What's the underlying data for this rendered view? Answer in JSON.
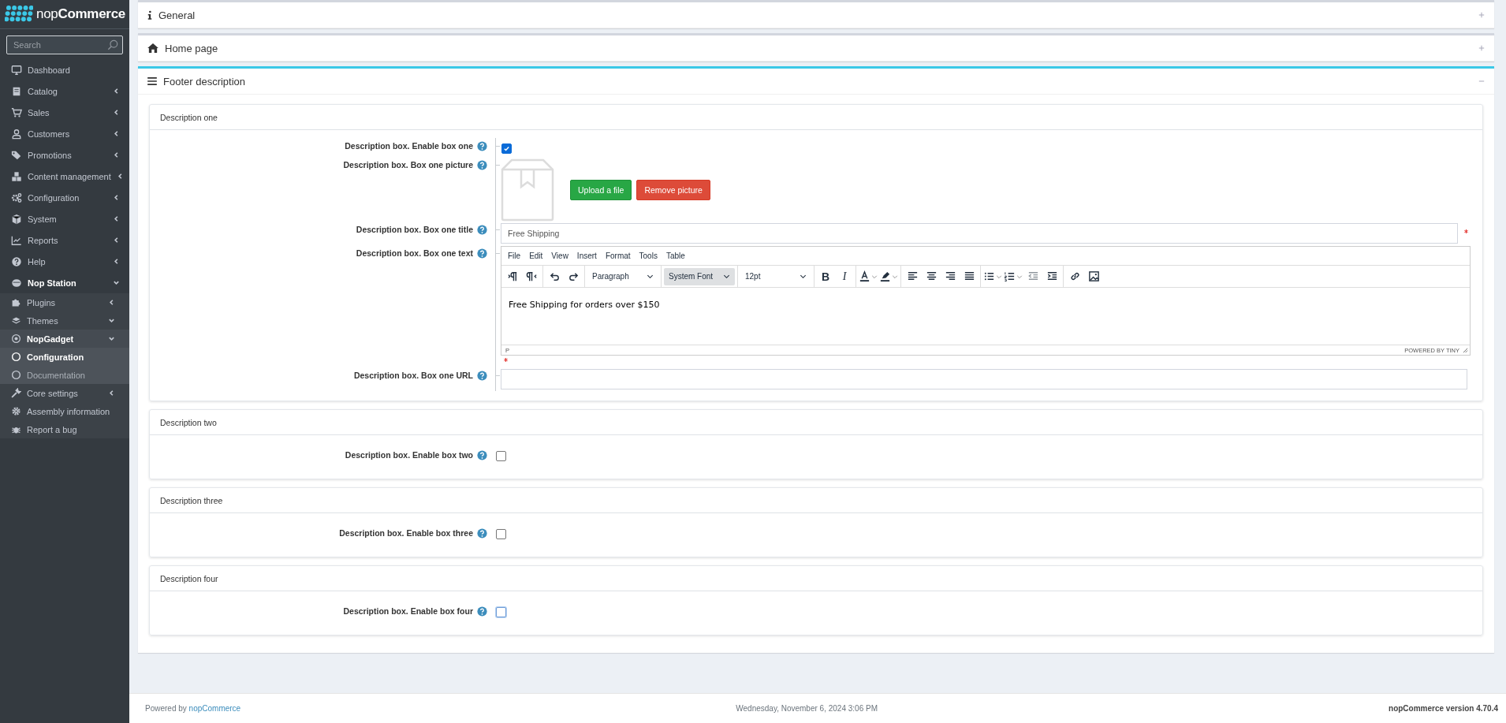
{
  "sidebar": {
    "logo": {
      "light": "nop",
      "bold": "Commerce"
    },
    "search": {
      "placeholder": "Search"
    },
    "items": [
      {
        "label": "Dashboard"
      },
      {
        "label": "Catalog",
        "expanded": false
      },
      {
        "label": "Sales",
        "expanded": false
      },
      {
        "label": "Customers",
        "expanded": false
      },
      {
        "label": "Promotions",
        "expanded": false
      },
      {
        "label": "Content management",
        "expanded": false
      },
      {
        "label": "Configuration",
        "expanded": false
      },
      {
        "label": "System",
        "expanded": false
      },
      {
        "label": "Reports",
        "expanded": false
      },
      {
        "label": "Help",
        "expanded": false
      },
      {
        "label": "Nop Station",
        "expanded": true,
        "children": [
          {
            "label": "Plugins",
            "expanded": false
          },
          {
            "label": "Themes",
            "expanded": true
          },
          {
            "label": "NopGadget",
            "expanded": true,
            "children": [
              {
                "label": "Configuration",
                "selected": true
              },
              {
                "label": "Documentation",
                "selected": false
              }
            ]
          },
          {
            "label": "Core settings",
            "expanded": false
          },
          {
            "label": "Assembly information"
          },
          {
            "label": "Report a bug"
          }
        ]
      }
    ]
  },
  "panels": [
    {
      "title": "General",
      "expanded": false
    },
    {
      "title": "Home page",
      "expanded": false
    },
    {
      "title": "Footer description",
      "expanded": true,
      "sections": [
        {
          "title": "Description one",
          "fields": [
            {
              "kind": "checkbox",
              "label": "Description box. Enable box one",
              "checked": true,
              "focused": false
            },
            {
              "kind": "picture",
              "label": "Description box. Box one picture",
              "buttons": [
                "Upload a file",
                "Remove picture"
              ]
            },
            {
              "kind": "text",
              "label": "Description box. Box one title",
              "value": "Free Shipping",
              "required": true
            },
            {
              "kind": "editor",
              "label": "Description box. Box one text",
              "menu": [
                "File",
                "Edit",
                "View",
                "Insert",
                "Format",
                "Tools",
                "Table"
              ],
              "selects": [
                {
                  "label": "Paragraph",
                  "selected": false
                },
                {
                  "label": "System Font",
                  "selected": true
                },
                {
                  "label": "12pt",
                  "selected": false
                }
              ],
              "format_buttons": [
                "B",
                "I"
              ],
              "content": "Free Shipping for orders over $150",
              "path": "P",
              "branding": "POWERED BY TINY",
              "required": true
            },
            {
              "kind": "text",
              "label": "Description box. Box one URL",
              "required": false
            }
          ]
        },
        {
          "title": "Description two",
          "fields": [
            {
              "kind": "checkbox",
              "label": "Description box. Enable box two",
              "checked": false,
              "focused": false
            }
          ]
        },
        {
          "title": "Description three",
          "fields": [
            {
              "kind": "checkbox",
              "label": "Description box. Enable box three",
              "checked": false,
              "focused": false
            }
          ]
        },
        {
          "title": "Description four",
          "fields": [
            {
              "kind": "checkbox",
              "label": "Description box. Enable box four",
              "checked": false,
              "focused": true
            }
          ]
        }
      ]
    }
  ],
  "footer": {
    "powered_by": "Powered by",
    "link": "nopCommerce",
    "date": "Wednesday, November 6, 2024 3:06 PM",
    "version": "nopCommerce version 4.70.4"
  }
}
